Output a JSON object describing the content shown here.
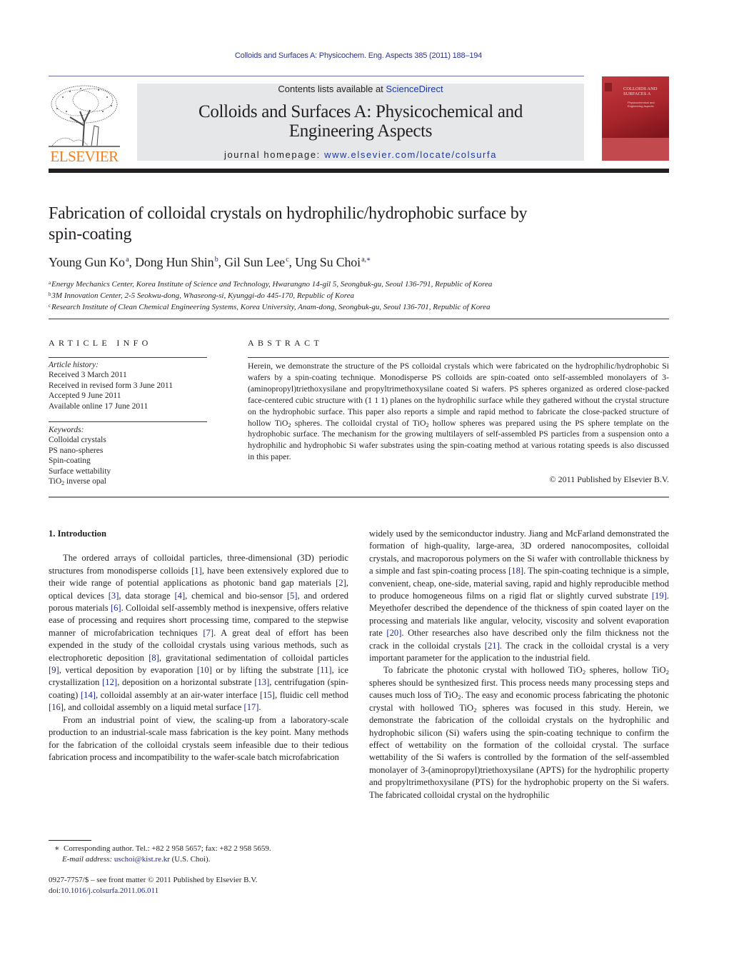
{
  "running_head": "Colloids and Surfaces A: Physicochem. Eng. Aspects 385 (2011) 188–194",
  "publisher": {
    "logo_text": "ELSEVIER",
    "logo_color": "#f07e1f"
  },
  "masthead": {
    "contents_prefix": "Contents lists available at ",
    "contents_link": "ScienceDirect",
    "journal_name_line1": "Colloids and Surfaces A: Physicochemical and",
    "journal_name_line2": "Engineering Aspects",
    "homepage_prefix": "journal homepage: ",
    "homepage_url": "www.elsevier.com/locate/colsurfa",
    "background_color": "#e6e7e8",
    "link_color": "#1c3aa5"
  },
  "cover": {
    "title_line1": "COLLOIDS AND",
    "title_line2": "SURFACES A",
    "subtitle": "Physicochemical and Engineering Aspects",
    "color": "#a8252b"
  },
  "article": {
    "title_line1": "Fabrication of colloidal crystals on hydrophilic/hydrophobic surface by",
    "title_line2": "spin-coating",
    "authors": [
      {
        "name": "Young Gun Ko",
        "affil": "a",
        "sep": ", "
      },
      {
        "name": "Dong Hun Shin",
        "affil": "b",
        "sep": ", "
      },
      {
        "name": "Gil Sun Lee",
        "affil": "c",
        "sep": ", "
      },
      {
        "name": "Ung Su Choi",
        "affil": "a,∗",
        "sep": ""
      }
    ],
    "affiliations": [
      {
        "key": "a",
        "text": "Energy Mechanics Center, Korea Institute of Science and Technology, Hwarangno 14-gil 5, Seongbuk-gu, Seoul 136-791, Republic of Korea"
      },
      {
        "key": "b",
        "text": "3M Innovation Center, 2-5 Seokwu-dong, Whaseong-si, Kyunggi-do 445-170, Republic of Korea"
      },
      {
        "key": "c",
        "text": "Research Institute of Clean Chemical Engineering Systems, Korea University, Anam-dong, Seongbuk-gu, Seoul 136-701, Republic of Korea"
      }
    ]
  },
  "article_info": {
    "heading": "ARTICLE INFO",
    "history_label": "Article history:",
    "history": [
      "Received 3 March 2011",
      "Received in revised form 3 June 2011",
      "Accepted 9 June 2011",
      "Available online 17 June 2011"
    ],
    "keywords_label": "Keywords:",
    "keywords": [
      "Colloidal crystals",
      "PS nano-spheres",
      "Spin-coating",
      "Surface wettability"
    ],
    "keyword_last_prefix": "TiO",
    "keyword_last_sub": "2",
    "keyword_last_suffix": " inverse opal"
  },
  "abstract": {
    "heading": "ABSTRACT",
    "part1": "Herein, we demonstrate the structure of the PS colloidal crystals which were fabricated on the hydrophilic/hydrophobic Si wafers by a spin-coating technique. Monodisperse PS colloids are spin-coated onto self-assembled monolayers of 3-(aminopropyl)triethoxysilane and propyltrimethoxysilane coated Si wafers. PS spheres organized as ordered close-packed face-centered cubic structure with (1 1 1) planes on the hydrophilic surface while they gathered without the crystal structure on the hydrophobic surface. This paper also reports a simple and rapid method to fabricate the close-packed structure of hollow TiO",
    "part2": " spheres. The colloidal crystal of TiO",
    "part3": " hollow spheres was prepared using the PS sphere template on the hydrophobic surface. The mechanism for the growing multilayers of self-assembled PS particles from a suspension onto a hydrophilic and hydrophobic Si wafer substrates using the spin-coating method at various rotating speeds is also discussed in this paper.",
    "sub": "2",
    "copyright": "© 2011 Published by Elsevier B.V."
  },
  "body": {
    "section1_heading": "1.  Introduction",
    "left_p1": [
      {
        "t": "The ordered arrays of colloidal particles, three-dimensional (3D) periodic structures from monodisperse colloids "
      },
      {
        "c": "[1]"
      },
      {
        "t": ", have been extensively explored due to their wide range of potential applications as photonic band gap materials "
      },
      {
        "c": "[2]"
      },
      {
        "t": ", optical devices "
      },
      {
        "c": "[3]"
      },
      {
        "t": ", data storage "
      },
      {
        "c": "[4]"
      },
      {
        "t": ", chemical and bio-sensor "
      },
      {
        "c": "[5]"
      },
      {
        "t": ", and ordered porous materials "
      },
      {
        "c": "[6]"
      },
      {
        "t": ". Colloidal self-assembly method is inexpensive, offers relative ease of processing and requires short processing time, compared to the stepwise manner of microfabrication techniques "
      },
      {
        "c": "[7]"
      },
      {
        "t": ". A great deal of effort has been expended in the study of the colloidal crystals using various methods, such as electrophoretic deposition "
      },
      {
        "c": "[8]"
      },
      {
        "t": ", gravitational sedimentation of colloidal particles "
      },
      {
        "c": "[9]"
      },
      {
        "t": ", vertical deposition by evaporation "
      },
      {
        "c": "[10]"
      },
      {
        "t": " or by lifting the substrate "
      },
      {
        "c": "[11]"
      },
      {
        "t": ", ice crystallization "
      },
      {
        "c": "[12]"
      },
      {
        "t": ", deposition on a horizontal substrate "
      },
      {
        "c": "[13]"
      },
      {
        "t": ", centrifugation (spin-coating) "
      },
      {
        "c": "[14]"
      },
      {
        "t": ", colloidal assembly at an air-water interface "
      },
      {
        "c": "[15]"
      },
      {
        "t": ", fluidic cell method "
      },
      {
        "c": "[16]"
      },
      {
        "t": ", and colloidal assembly on a liquid metal surface "
      },
      {
        "c": "[17]"
      },
      {
        "t": "."
      }
    ],
    "left_p2": "From an industrial point of view, the scaling-up from a laboratory-scale production to an industrial-scale mass fabrication is the key point. Many methods for the fabrication of the colloidal crystals seem infeasible due to their tedious fabrication process and incompatibility to the wafer-scale batch microfabrication",
    "right_p1": [
      {
        "t": "widely used by the semiconductor industry. Jiang and McFarland demonstrated the formation of high-quality, large-area, 3D ordered nanocomposites, colloidal crystals, and macroporous polymers on the Si wafer with controllable thickness by a simple and fast spin-coating process "
      },
      {
        "c": "[18]"
      },
      {
        "t": ". The spin-coating technique is a simple, convenient, cheap, one-side, material saving, rapid and highly reproducible method to produce homogeneous films on a rigid flat or slightly curved substrate "
      },
      {
        "c": "[19]"
      },
      {
        "t": ". Meyethofer described the dependence of the thickness of spin coated layer on the processing and materials like angular, velocity, viscosity and solvent evaporation rate "
      },
      {
        "c": "[20]"
      },
      {
        "t": ". Other researches also have described only the film thickness not the crack in the colloidal crystals "
      },
      {
        "c": "[21]"
      },
      {
        "t": ". The crack in the colloidal crystal is a very important parameter for the application to the industrial field."
      }
    ],
    "right_p2": [
      {
        "t": "To fabricate the photonic crystal with hollowed TiO"
      },
      {
        "s": "2"
      },
      {
        "t": " spheres, hollow TiO"
      },
      {
        "s": "2"
      },
      {
        "t": " spheres should be synthesized first. This process needs many processing steps and causes much loss of TiO"
      },
      {
        "s": "2"
      },
      {
        "t": ". The easy and economic process fabricating the photonic crystal with hollowed TiO"
      },
      {
        "s": "2"
      },
      {
        "t": " spheres was focused in this study. Herein, we demonstrate the fabrication of the colloidal crystals on the hydrophilic and hydrophobic silicon (Si) wafers using the spin-coating technique to confirm the effect of wettability on the formation of the colloidal crystal. The surface wettability of the Si wafers is controlled by the formation of the self-assembled monolayer of 3-(aminopropyl)triethoxysilane (APTS) for the hydrophilic property and propyltrimethoxysilane (PTS) for the hydrophobic property on the Si wafers. The fabricated colloidal crystal on the hydrophilic"
      }
    ],
    "citation_color": "#1c2a8c"
  },
  "footnote": {
    "marker": "∗",
    "corresponding": "Corresponding author. Tel.: +82 2 958 5657; fax: +82 2 958 5659.",
    "email_label": "E-mail address:",
    "email": "uschoi@kist.re.kr",
    "email_suffix": " (U.S. Choi)."
  },
  "front_matter": {
    "issn_line": "0927-7757/$ – see front matter © 2011 Published by Elsevier B.V.",
    "doi_prefix": "doi:",
    "doi": "10.1016/j.colsurfa.2011.06.011"
  }
}
